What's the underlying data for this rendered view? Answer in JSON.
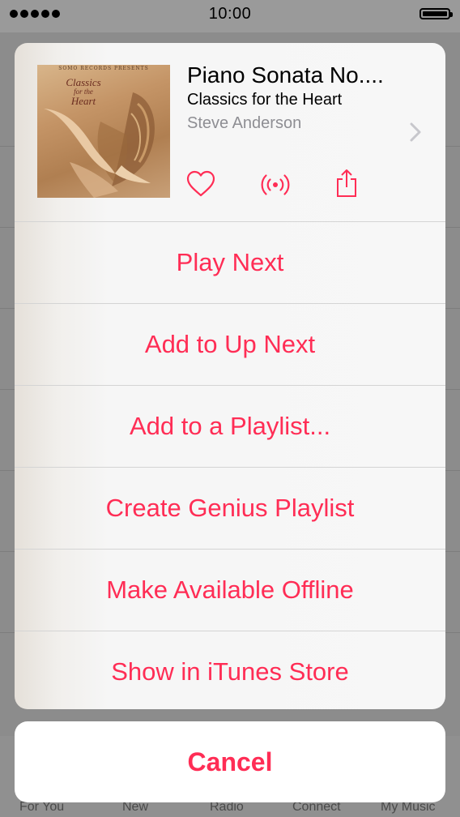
{
  "status_bar": {
    "time": "10:00"
  },
  "now_playing": {
    "song_title": "Piano Sonata No....",
    "album": "Classics for the Heart",
    "artist": "Steve Anderson",
    "artwork": {
      "publisher_text": "SOMO RECORDS PRESENTS",
      "title_words": [
        "Classics",
        "for the",
        "Heart"
      ]
    },
    "actions": [
      {
        "icon": "heart-icon",
        "label": "Love"
      },
      {
        "icon": "radio-station-icon",
        "label": "Start Station"
      },
      {
        "icon": "share-icon",
        "label": "Share"
      }
    ]
  },
  "menu": {
    "items": [
      {
        "label": "Play Next"
      },
      {
        "label": "Add to Up Next"
      },
      {
        "label": "Add to a Playlist..."
      },
      {
        "label": "Create Genius Playlist"
      },
      {
        "label": "Make Available Offline"
      },
      {
        "label": "Show in iTunes Store"
      }
    ]
  },
  "cancel_label": "Cancel",
  "tab_bar": {
    "tabs": [
      {
        "label": "For You"
      },
      {
        "label": "New"
      },
      {
        "label": "Radio"
      },
      {
        "label": "Connect"
      },
      {
        "label": "My Music"
      }
    ]
  },
  "colors": {
    "accent": "#ff2d55",
    "secondary_text": "#8e8e93",
    "sheet_background": "#f7f7f7",
    "dim_background": "#8f8f8f"
  }
}
